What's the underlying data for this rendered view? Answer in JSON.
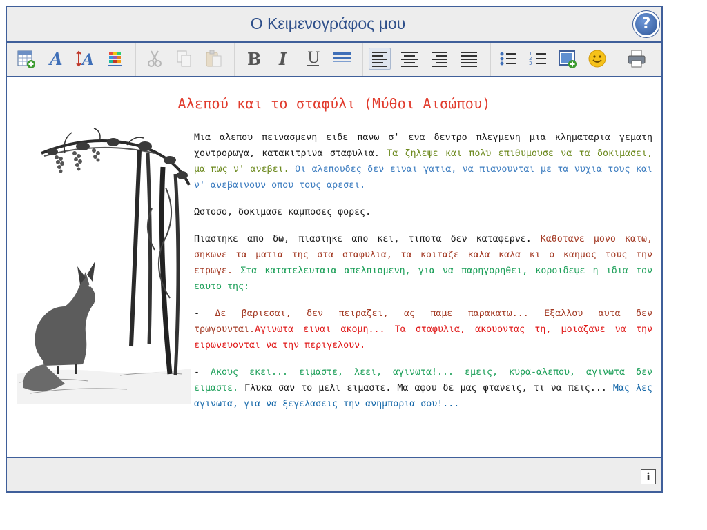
{
  "app": {
    "title": "Ο Κειμενογράφος μου",
    "help_label": "?"
  },
  "toolbar": {
    "buttons": [
      {
        "name": "insert-table-icon",
        "enabled": true
      },
      {
        "name": "font-style-icon",
        "enabled": true
      },
      {
        "name": "font-size-icon",
        "enabled": true
      },
      {
        "name": "font-color-icon",
        "enabled": true
      },
      {
        "name": "cut-icon",
        "enabled": false
      },
      {
        "name": "copy-icon",
        "enabled": false
      },
      {
        "name": "paste-icon",
        "enabled": false
      },
      {
        "name": "bold-icon",
        "enabled": true,
        "label": "B"
      },
      {
        "name": "italic-icon",
        "enabled": true,
        "label": "I"
      },
      {
        "name": "underline-icon",
        "enabled": true,
        "label": "U"
      },
      {
        "name": "line-spacing-icon",
        "enabled": true
      },
      {
        "name": "align-left-icon",
        "enabled": true,
        "active": true
      },
      {
        "name": "align-center-icon",
        "enabled": true
      },
      {
        "name": "align-right-icon",
        "enabled": true
      },
      {
        "name": "align-justify-icon",
        "enabled": true
      },
      {
        "name": "bullet-list-icon",
        "enabled": true
      },
      {
        "name": "numbered-list-icon",
        "enabled": true
      },
      {
        "name": "insert-image-icon",
        "enabled": true
      },
      {
        "name": "emoticon-icon",
        "enabled": true
      },
      {
        "name": "print-icon",
        "enabled": true
      }
    ]
  },
  "document": {
    "title": "Αλεπού και το σταφύλι (Μύθοι Αισώπου)",
    "paragraphs": [
      [
        {
          "text": "Μια αλεπου πεινασμενη ειδε πανω σ' ενα δεντρο πλεγμενη μια κληματαρια γεματη χοντρορωγα, κατακιτρινα σταφυλια. ",
          "color": "c-blk"
        },
        {
          "text": "Τα ζηλεψε και πολυ επιθυμουσε να τα δοκιμασει, μα πως ν' ανεβει. ",
          "color": "c-olive"
        },
        {
          "text": "Οι αλεπουδες δεν ειναι γατια, να πιανουνται με τα νυχια τους και ν' ανεβαινουν οπου τους αρεσει.",
          "color": "c-blue"
        }
      ],
      [
        {
          "text": "Ωστοσο, δοκιμασε καμποσες φορες.",
          "color": "c-blk"
        }
      ],
      [
        {
          "text": "Πιαστηκε απο δω, πιαστηκε απο κει, τιποτα δεν καταφερνε. ",
          "color": "c-blk"
        },
        {
          "text": "Καθοτανε μονο κατω, σηκωνε τα ματια της στα σταφυλια, τα κοιταζε καλα καλα κι ο καημος τους την ετρωγε. ",
          "color": "c-brown"
        },
        {
          "text": "Στα κατατελευταια απελπισμενη, για να παρηγορηθει, κοροιδεψε η ιδια τον εαυτο της:",
          "color": "c-green"
        }
      ],
      [
        {
          "text": "- ",
          "color": "c-blk"
        },
        {
          "text": "Δε βαριεσαι, δεν πειραζει, ας παμε παρακατω... Εξαλλου αυτα δεν τρωγουνται.",
          "color": "c-brown"
        },
        {
          "text": "Αγινωτα ειναι ακομη... Τα σταφυλια, ακουοντας τη, μοιαζανε να την ειρωνευονται να την περιγελουν.",
          "color": "c-red"
        }
      ],
      [
        {
          "text": "- ",
          "color": "c-blk"
        },
        {
          "text": "Ακους εκει... ειμαστε, λεει, αγινωτα!... εμεις, κυρα-αλεπου, αγινωτα δεν ειμαστε. ",
          "color": "c-green"
        },
        {
          "text": "Γλυκα σαν το μελι ειμαστε. Μα αφου δε μας φτανεις, τι να πεις... ",
          "color": "c-blk"
        },
        {
          "text": "Μας λες αγινωτα, για να ξεγελασεις την ανημπορια σου!...",
          "color": "c-dblue"
        }
      ]
    ]
  },
  "status": {
    "info_label": "i"
  }
}
